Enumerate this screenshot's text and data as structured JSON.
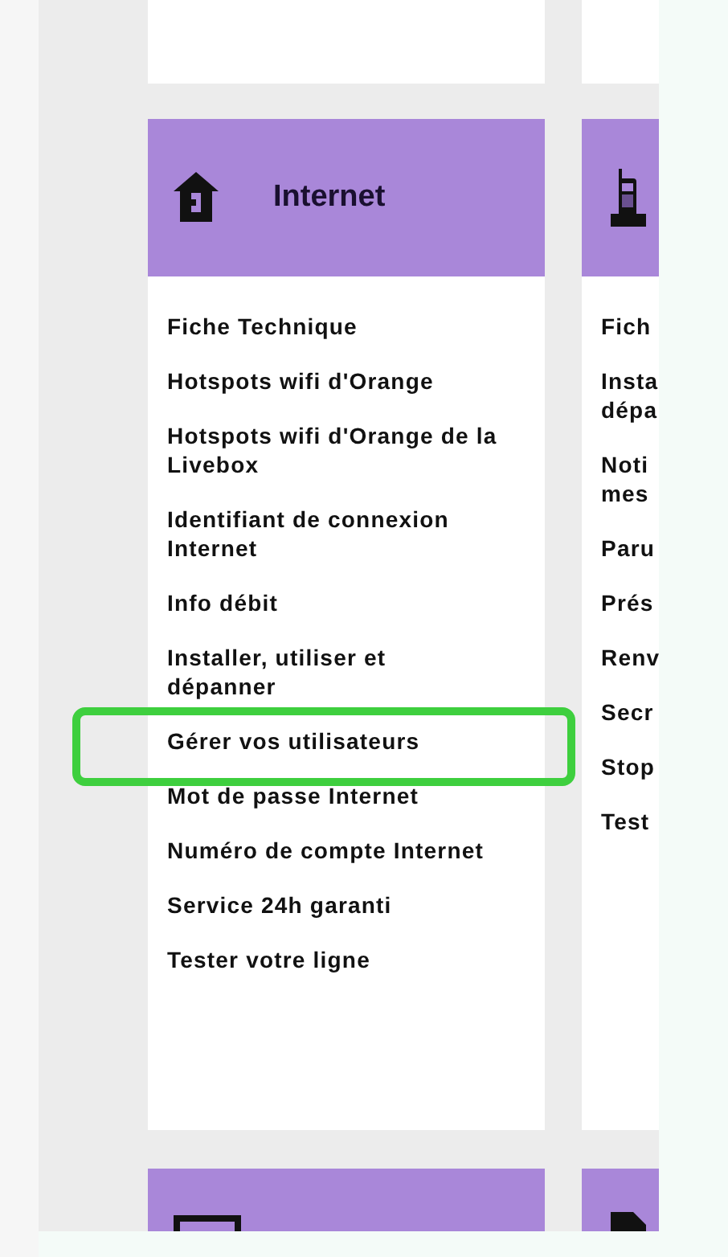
{
  "columns": [
    {
      "title": "Internet",
      "items": [
        {
          "lines": [
            "Fiche Technique"
          ],
          "highlighted": false
        },
        {
          "lines": [
            "Hotspots wifi d'Orange"
          ],
          "highlighted": false
        },
        {
          "lines": [
            "Hotspots wifi d'Orange de la",
            "Livebox"
          ],
          "highlighted": false
        },
        {
          "lines": [
            "Identifiant de connexion",
            "Internet"
          ],
          "highlighted": false
        },
        {
          "lines": [
            "Info débit"
          ],
          "highlighted": false
        },
        {
          "lines": [
            "Installer, utiliser et",
            "dépanner"
          ],
          "highlighted": false
        },
        {
          "lines": [
            "Gérer vos utilisateurs"
          ],
          "highlighted": true
        },
        {
          "lines": [
            "Mot de passe Internet"
          ],
          "highlighted": false
        },
        {
          "lines": [
            "Numéro de compte Internet"
          ],
          "highlighted": false
        },
        {
          "lines": [
            "Service 24h garanti"
          ],
          "highlighted": false
        },
        {
          "lines": [
            "Tester votre ligne"
          ],
          "highlighted": false
        }
      ]
    },
    {
      "items": [
        {
          "lines": [
            "Fich"
          ],
          "highlighted": false
        },
        {
          "lines": [
            "Insta",
            "dépa"
          ],
          "highlighted": false
        },
        {
          "lines": [
            "Noti",
            "mes"
          ],
          "highlighted": false
        },
        {
          "lines": [
            "Paru"
          ],
          "highlighted": false
        },
        {
          "lines": [
            "Prés"
          ],
          "highlighted": false
        },
        {
          "lines": [
            "Renv"
          ],
          "highlighted": false
        },
        {
          "lines": [
            "Secr"
          ],
          "highlighted": false
        },
        {
          "lines": [
            "Stop"
          ],
          "highlighted": false
        },
        {
          "lines": [
            "Test"
          ],
          "highlighted": false
        }
      ]
    }
  ]
}
